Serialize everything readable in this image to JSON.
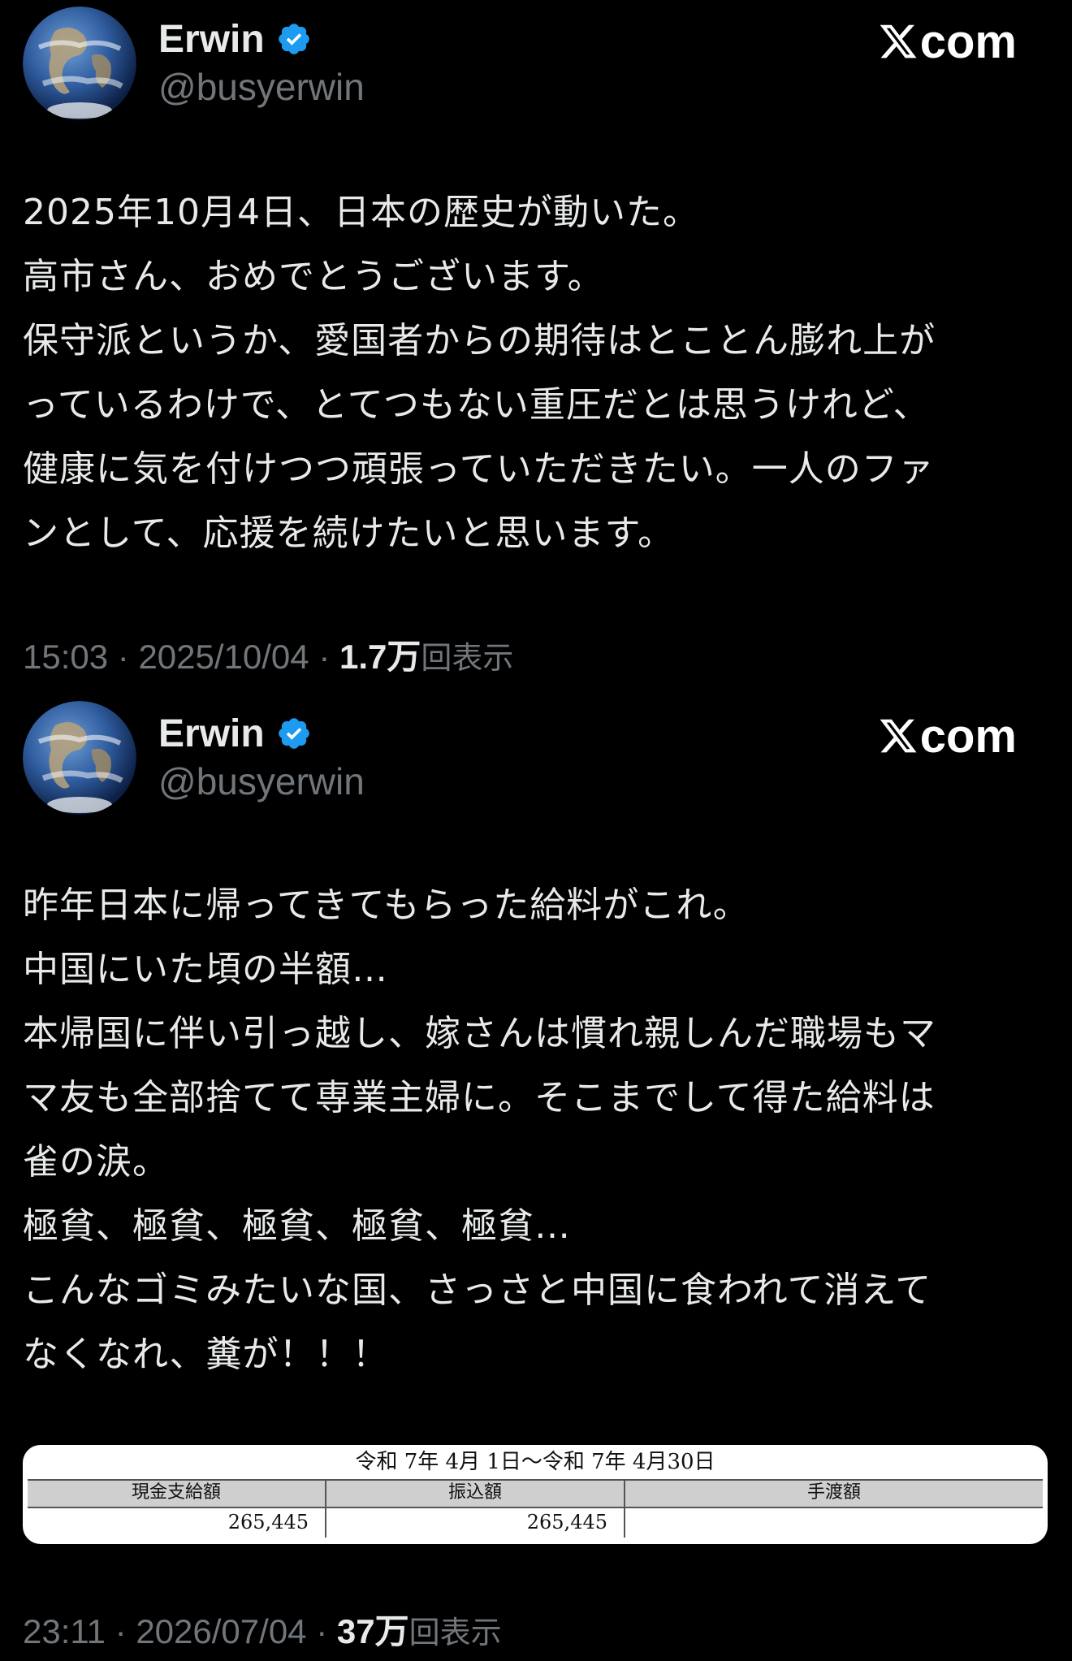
{
  "tweets": [
    {
      "author": {
        "display_name": "Erwin",
        "handle": "@busyerwin",
        "verified": true
      },
      "site": "com",
      "body": "2025年10月4日、日本の歴史が動いた。\n高市さん、おめでとうございます。\n保守派というか、愛国者からの期待はとことん膨れ上が\nっているわけで、とてつもない重圧だとは思うけれど、\n健康に気を付けつつ頑張っていただきたい。一人のファ\nンとして、応援を続けたいと思います。",
      "time": "15:03",
      "date": "2025/10/04",
      "views_count": "1.7万",
      "views_label": "回表示"
    },
    {
      "author": {
        "display_name": "Erwin",
        "handle": "@busyerwin",
        "verified": true
      },
      "site": "com",
      "body": "昨年日本に帰ってきてもらった給料がこれ。\n中国にいた頃の半額…\n本帰国に伴い引っ越し、嫁さんは慣れ親しんだ職場もマ\nマ友も全部捨てて専業主婦に。そこまでして得た給料は\n雀の涙。\n極貧、極貧、極貧、極貧、極貧…\nこんなゴミみたいな国、さっさと中国に食われて消えて\nなくなれ、糞が！！！",
      "payslip": {
        "period": "令和 7年 4月 1日〜令和 7年 4月30日",
        "headers": [
          "現金支給額",
          "振込額",
          "手渡額"
        ],
        "values": [
          "265,445",
          "265,445",
          ""
        ]
      },
      "time": "23:11",
      "date": "2026/07/04",
      "views_count": "37万",
      "views_label": "回表示"
    }
  ],
  "colors": {
    "background": "#000000",
    "text_primary": "#e7e9ea",
    "text_secondary": "#71767b",
    "verified_badge": "#1d9bf0"
  },
  "icons": [
    "earth-avatar-icon",
    "verified-badge-icon",
    "x-logo-icon"
  ]
}
